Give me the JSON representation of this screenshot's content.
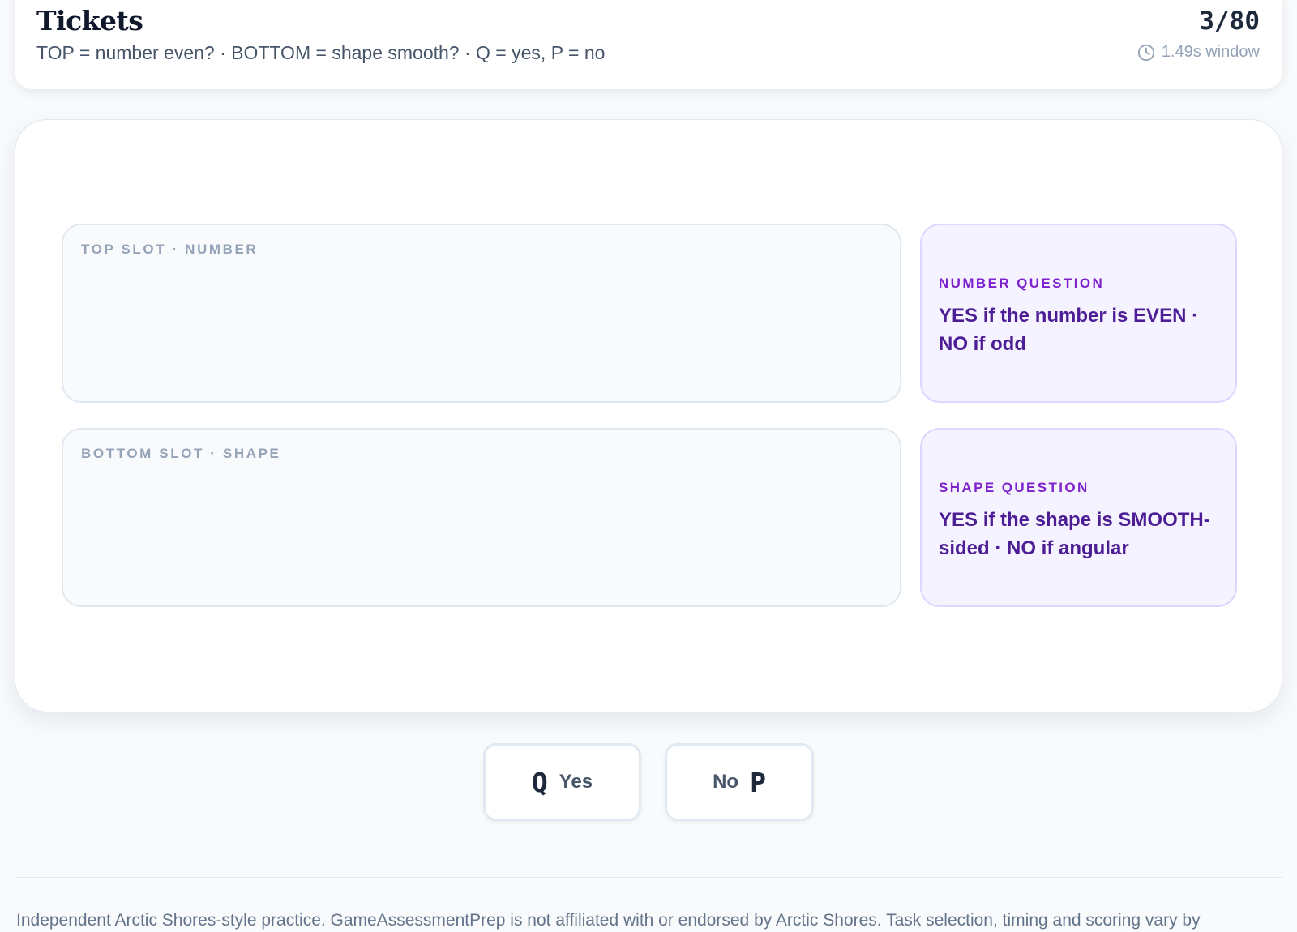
{
  "header": {
    "title": "Tickets",
    "subtitle": "TOP = number even? · BOTTOM = shape smooth? · Q = yes, P = no",
    "counter": "3/80",
    "timer_label": "1.49s window",
    "timer_icon": "clock-icon"
  },
  "slots": {
    "top_label": "TOP SLOT · NUMBER",
    "bottom_label": "BOTTOM SLOT · SHAPE"
  },
  "questions": {
    "number": {
      "label": "NUMBER QUESTION",
      "text": "YES if the number is EVEN · NO if odd"
    },
    "shape": {
      "label": "SHAPE QUESTION",
      "text": "YES if the shape is SMOOTH-sided · NO if angular"
    }
  },
  "buttons": {
    "yes": {
      "key": "Q",
      "label": "Yes"
    },
    "no": {
      "key": "P",
      "label": "No"
    }
  },
  "footer": {
    "text": "Independent Arctic Shores-style practice. GameAssessmentPrep is not affiliated with or endorsed by Arctic Shores. Task selection, timing and scoring vary by"
  },
  "colors": {
    "background": "#f8fafc",
    "question_bg": "#f5f3ff",
    "question_label": "#7e22ce",
    "question_text": "#4c1d95",
    "muted": "#94a3b8"
  }
}
